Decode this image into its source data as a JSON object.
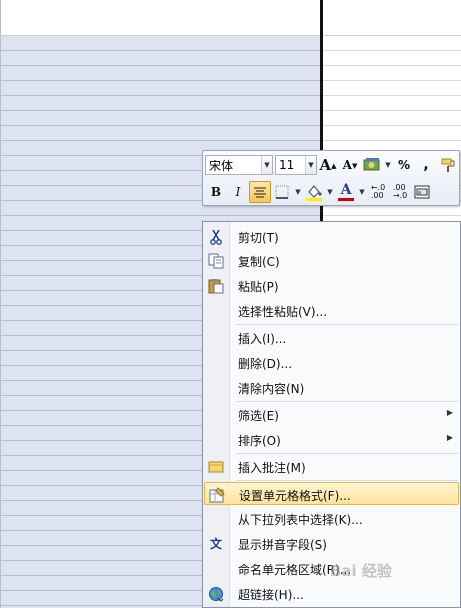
{
  "minibar": {
    "font_name": "宋体",
    "font_size": "11",
    "grow_font": "A",
    "shrink_font": "A",
    "percent": "%",
    "comma": ",",
    "bold": "B",
    "italic": "I",
    "font_color": "A",
    "inc_decimal": "+.0\n.00",
    "dec_decimal": ".00\n+.0",
    "icons": [
      "format-painter-icon",
      "borders-icon",
      "fill-color-icon",
      "merge-cells-icon"
    ]
  },
  "menu": {
    "items": [
      {
        "label": "剪切(T)",
        "icon": "✂"
      },
      {
        "label": "复制(C)",
        "icon": "⎘"
      },
      {
        "label": "粘贴(P)",
        "icon": "📋"
      },
      {
        "label": "选择性粘贴(V)..."
      },
      {
        "label": "插入(I)..."
      },
      {
        "label": "删除(D)..."
      },
      {
        "label": "清除内容(N)"
      },
      {
        "label": "筛选(E)",
        "submenu": "▶"
      },
      {
        "label": "排序(O)",
        "submenu": "▶"
      },
      {
        "label": "插入批注(M)"
      },
      {
        "label": "设置单元格格式(F)..."
      },
      {
        "label": "从下拉列表中选择(K)..."
      },
      {
        "label": "显示拼音字段(S)",
        "icon": "文"
      },
      {
        "label": "命名单元格区域(R)..."
      },
      {
        "label": "超链接(H)..."
      }
    ]
  },
  "watermark": "Bai 经验",
  "colors": {
    "selection": "#dde3f1",
    "highlight": "#ffe39a",
    "font_color_bar": "#d10000",
    "fill_color_bar": "#ffee00"
  }
}
